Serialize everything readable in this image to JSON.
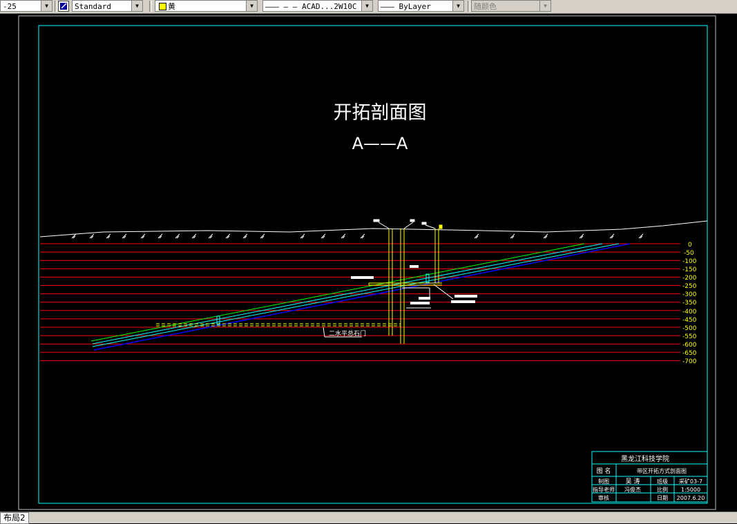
{
  "toolbar": {
    "dimstyle_value": "-25",
    "textstyle_value": "Standard",
    "layer_value": "黄",
    "linetype_value": "——— — — ACAD...2W10C",
    "lineweight_value": "——— ByLayer",
    "plotstyle_value": "随颜色"
  },
  "drawing": {
    "title": "开拓剖面图",
    "subtitle": "A——A",
    "label_crosscut": "二水平总石门",
    "depth_labels": [
      "0",
      "-50",
      "-100",
      "-150",
      "-200",
      "-250",
      "-300",
      "-350",
      "-400",
      "-450",
      "-500",
      "-550",
      "-600",
      "-650",
      "-700"
    ]
  },
  "title_block": {
    "school": "黑龙江科技学院",
    "name_label": "图 名",
    "name_value": "带区开拓方式剖面图",
    "row1": {
      "c1": "制图",
      "c2": "吴 涛",
      "c3": "班级",
      "c4": "采矿03-7"
    },
    "row2": {
      "c1": "指导老师",
      "c2": "冯俊杰",
      "c3": "比例",
      "c4": "1:5000"
    },
    "row3": {
      "c1": "审核",
      "c2": "",
      "c3": "日期",
      "c4": "2007.6.20"
    }
  },
  "statusbar": {
    "layout_tab": "布局2"
  },
  "colors": {
    "frame": "#00ffff",
    "level_lines": "#ff0000",
    "labels": "#ffff00",
    "seam_green": "#00ff00",
    "seam_cyan": "#00ffff",
    "seam_blue": "#0000ff"
  }
}
